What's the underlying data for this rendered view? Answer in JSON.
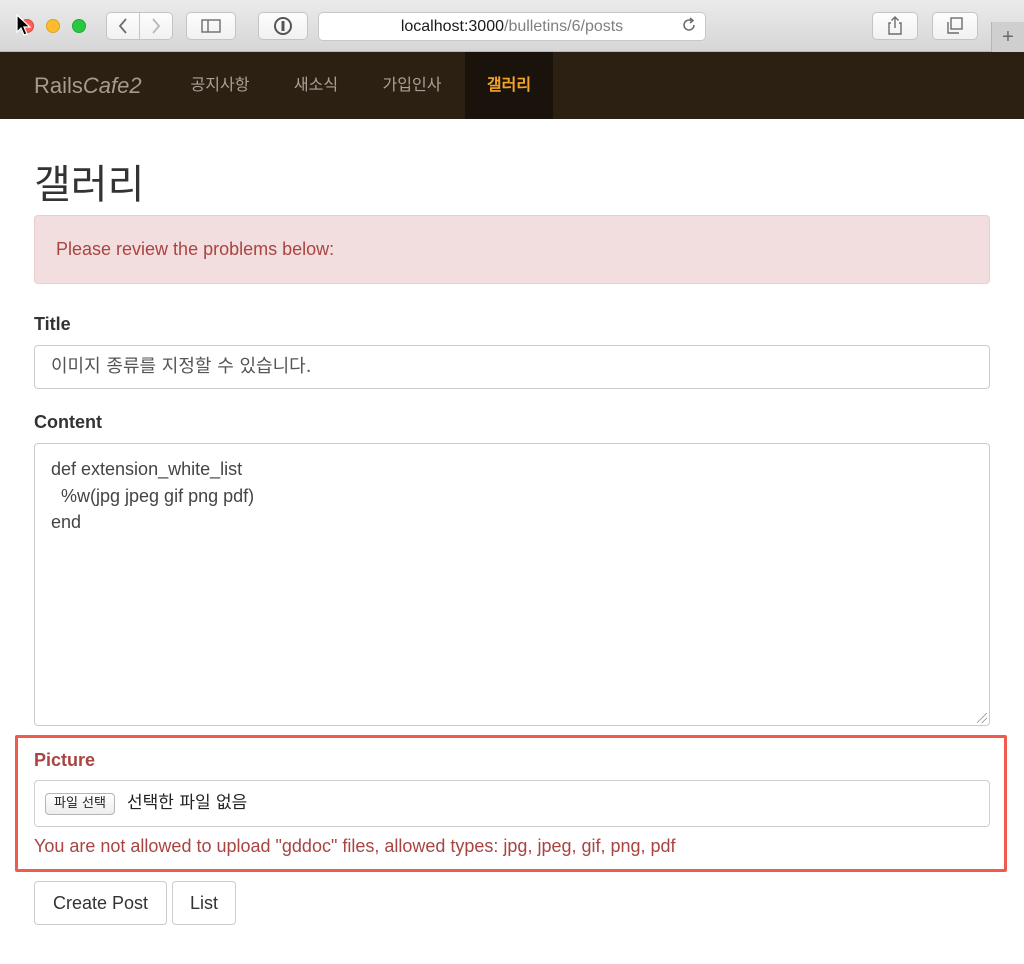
{
  "browser": {
    "url_host": "localhost:3000",
    "url_path": "/bulletins/6/posts"
  },
  "navbar": {
    "brand_prefix": "Rails",
    "brand_suffix": "Cafe2",
    "items": [
      {
        "label": "공지사항",
        "active": false
      },
      {
        "label": "새소식",
        "active": false
      },
      {
        "label": "가입인사",
        "active": false
      },
      {
        "label": "갤러리",
        "active": true
      }
    ]
  },
  "page": {
    "title": "갤러리",
    "alert": "Please review the problems below:"
  },
  "form": {
    "title_label": "Title",
    "title_value": "이미지 종류를 지정할 수 있습니다.",
    "content_label": "Content",
    "content_value": "def extension_white_list\n  %w(jpg jpeg gif png pdf)\nend",
    "picture_label": "Picture",
    "file_button": "파일 선택",
    "file_status": "선택한 파일 없음",
    "picture_error": "You are not allowed to upload \"gddoc\" files, allowed types: jpg, jpeg, gif, png, pdf",
    "submit_label": "Create Post",
    "list_label": "List"
  },
  "colors": {
    "navbar_bg": "#2c2013",
    "nav_active": "#f5a42a",
    "error": "#a94442",
    "highlight_border": "#ef5c4e"
  }
}
